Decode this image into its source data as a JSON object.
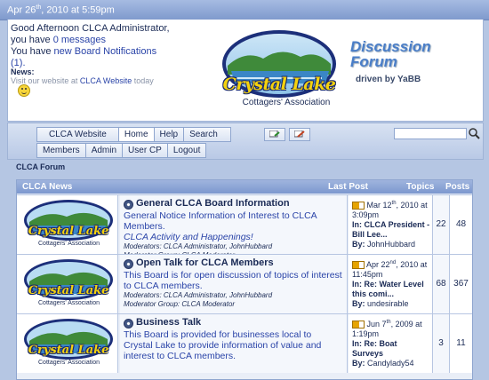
{
  "datebar": {
    "day": "Apr 26",
    "suffix": "th",
    "rest": ", 2010 at 5:59pm"
  },
  "greeting": {
    "line1": "Good Afternoon CLCA Administrator,",
    "line2a": "you have ",
    "line2b": "0 messages",
    "line3a": "You have ",
    "line3b": "new Board Notifications",
    "line4": "(1)."
  },
  "news": {
    "label": "News:",
    "text_pre": "Visit our website at ",
    "link": "CLCA Website",
    "text_post": " today"
  },
  "logo": {
    "title": "Crystal Lake",
    "subtitle": "Cottagers' Association"
  },
  "forum_brand": {
    "line1": "Discussion",
    "line2": "Forum",
    "sub": "driven by YaBB"
  },
  "nav": {
    "row1": [
      "CLCA Website",
      "Home",
      "Help",
      "Search"
    ],
    "row2": [
      "Members",
      "Admin",
      "User CP",
      "Logout"
    ]
  },
  "breadcrumb": "CLCA Forum",
  "board": {
    "category": "CLCA News",
    "col_last": "Last Post",
    "col_topics": "Topics",
    "col_posts": "Posts",
    "image_title": "Crystal Lake",
    "image_sub": "Cottagers' Association",
    "rows": [
      {
        "name": "General CLCA Board Information",
        "desc": "General Notice Information of Interest to CLCA Members.",
        "italic": "CLCA Activity and Happenings!",
        "mods": "Moderators: CLCA Administrator, JohnHubbard",
        "group": "Moderator Group: CLCA Moderator",
        "lp_date": "Mar 12",
        "lp_sup": "th",
        "lp_year": ", 2010 at 3:09pm",
        "lp_in_label": "In:",
        "lp_in": " CLCA President - Bill Lee...",
        "lp_by_label": "By:",
        "lp_by": " JohnHubbard",
        "topics": "22",
        "posts": "48"
      },
      {
        "name": "Open Talk for CLCA Members",
        "desc": "This Board is for open discussion of topics of interest to CLCA members.",
        "italic": "",
        "mods": "Moderators: CLCA Administrator, JohnHubbard",
        "group": "Moderator Group: CLCA Moderator",
        "lp_date": "Apr 22",
        "lp_sup": "nd",
        "lp_year": ", 2010 at 11:45pm",
        "lp_in_label": "In:",
        "lp_in": " Re: Water Level this comi...",
        "lp_by_label": "By:",
        "lp_by": " undesirable",
        "topics": "68",
        "posts": "367"
      },
      {
        "name": "Business Talk",
        "desc": "This Board is provided for businesses local to Crystal Lake to provide information of value and interest to CLCA members.",
        "italic": "",
        "mods": "",
        "group": "",
        "lp_date": "Jun 7",
        "lp_sup": "th",
        "lp_year": ", 2009 at 1:19pm",
        "lp_in_label": "In:",
        "lp_in": " Re: Boat Surveys",
        "lp_by_label": "By:",
        "lp_by": " Candylady54",
        "topics": "3",
        "posts": "11"
      }
    ]
  }
}
